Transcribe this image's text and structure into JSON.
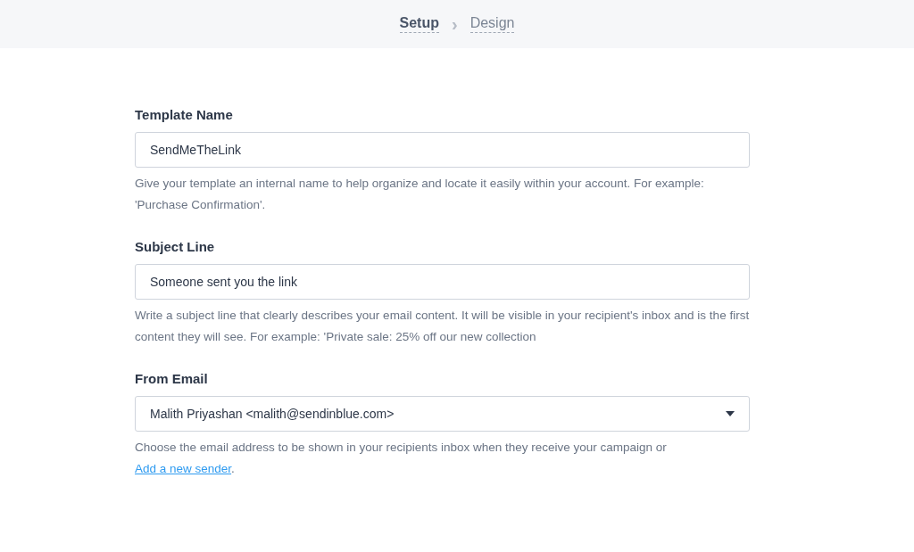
{
  "steps": [
    {
      "label": "Setup",
      "selected": true
    },
    {
      "label": "Design",
      "selected": false
    }
  ],
  "step_separator": "›",
  "fields": [
    {
      "kind": "text",
      "label": "Template Name",
      "value": "SendMeTheLink",
      "help": "Give your template an internal name to help organize and locate it easily within your account. For example: 'Purchase Confirmation'."
    },
    {
      "kind": "text",
      "label": "Subject Line",
      "value": "Someone sent you the link",
      "help": "Write a subject line that clearly describes your email content. It will be visible in your recipient's inbox and is the first content they will see. For example: 'Private sale: 25% off our new collection"
    },
    {
      "kind": "select",
      "label": "From Email",
      "value": "Malith Priyashan <malith@sendinblue.com>",
      "help": "Choose the email address to be shown in your recipients inbox when they receive your campaign or ",
      "link": "Add a new sender",
      "help_after": "."
    }
  ]
}
